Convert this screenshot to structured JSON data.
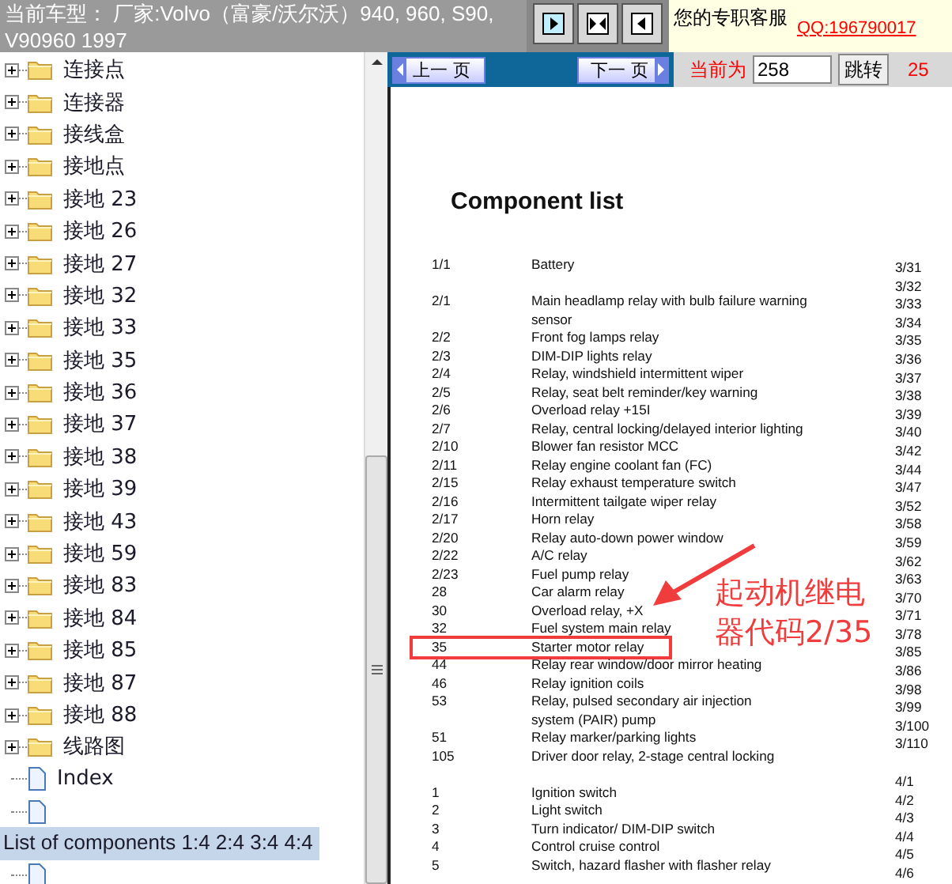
{
  "header": {
    "car_model": "当前车型：  厂家:Volvo（富豪/沃尔沃）940, 960, S90, V90960 1997",
    "service_label": "您的专职客服",
    "qq_link": "QQ:196790017"
  },
  "nav": {
    "prev": "上一 页",
    "next": "下一 页",
    "current_label": "当前为",
    "page_value": "258",
    "jump": "跳转",
    "total": "25"
  },
  "tree": [
    {
      "kind": "folder",
      "label": "连接点",
      "selected": false
    },
    {
      "kind": "folder",
      "label": "连接器",
      "selected": false
    },
    {
      "kind": "folder",
      "label": "接线盒",
      "selected": false
    },
    {
      "kind": "folder",
      "label": "接地点",
      "selected": false
    },
    {
      "kind": "folder",
      "label": "接地 23",
      "selected": false
    },
    {
      "kind": "folder",
      "label": "接地 26",
      "selected": false
    },
    {
      "kind": "folder",
      "label": "接地 27",
      "selected": false
    },
    {
      "kind": "folder",
      "label": "接地 32",
      "selected": false
    },
    {
      "kind": "folder",
      "label": "接地 33",
      "selected": false
    },
    {
      "kind": "folder",
      "label": "接地 35",
      "selected": false
    },
    {
      "kind": "folder",
      "label": "接地 36",
      "selected": false
    },
    {
      "kind": "folder",
      "label": "接地 37",
      "selected": false
    },
    {
      "kind": "folder",
      "label": "接地 38",
      "selected": false
    },
    {
      "kind": "folder",
      "label": "接地 39",
      "selected": false
    },
    {
      "kind": "folder",
      "label": "接地 43",
      "selected": false
    },
    {
      "kind": "folder",
      "label": "接地 59",
      "selected": false
    },
    {
      "kind": "folder",
      "label": "接地 83",
      "selected": false
    },
    {
      "kind": "folder",
      "label": "接地 84",
      "selected": false
    },
    {
      "kind": "folder",
      "label": "接地 85",
      "selected": false
    },
    {
      "kind": "folder",
      "label": "接地 87",
      "selected": false
    },
    {
      "kind": "folder",
      "label": "接地 88",
      "selected": false
    },
    {
      "kind": "folder",
      "label": "线路图",
      "selected": false
    },
    {
      "kind": "document",
      "label": "Index",
      "selected": false
    },
    {
      "kind": "document",
      "selected": false
    },
    {
      "kind": "text",
      "label": "List of components 1:4 2:4 3:4 4:4",
      "selected": true
    },
    {
      "kind": "document",
      "selected": false
    }
  ],
  "document": {
    "title": "Component list",
    "groups": [
      [
        {
          "code": "1/1",
          "lines": [
            "Battery"
          ],
          "highlighted": false
        }
      ],
      [
        {
          "code": "2/1",
          "lines": [
            "Main headlamp relay with bulb failure warning",
            "sensor"
          ],
          "highlighted": false
        },
        {
          "code": "2/2",
          "lines": [
            "Front fog lamps relay"
          ],
          "highlighted": false
        },
        {
          "code": "2/3",
          "lines": [
            "DIM-DIP lights relay"
          ],
          "highlighted": false
        },
        {
          "code": "2/4",
          "lines": [
            "Relay, windshield intermittent wiper"
          ],
          "highlighted": false
        },
        {
          "code": "2/5",
          "lines": [
            "Relay, seat belt reminder/key warning"
          ],
          "highlighted": false
        },
        {
          "code": "2/6",
          "lines": [
            "Overload relay +15I"
          ],
          "highlighted": false
        },
        {
          "code": "2/7",
          "lines": [
            "Relay, central locking/delayed interior lighting"
          ],
          "highlighted": false
        },
        {
          "code": "2/10",
          "lines": [
            "Blower fan resistor MCC"
          ],
          "highlighted": false
        },
        {
          "code": "2/11",
          "lines": [
            "Relay engine coolant fan (FC)"
          ],
          "highlighted": false
        },
        {
          "code": "2/15",
          "lines": [
            "Relay exhaust temperature switch"
          ],
          "highlighted": false
        },
        {
          "code": "2/16",
          "lines": [
            "Intermittent tailgate wiper relay"
          ],
          "highlighted": false
        },
        {
          "code": "2/17",
          "lines": [
            "Horn relay"
          ],
          "highlighted": false
        },
        {
          "code": "2/20",
          "lines": [
            "Relay auto-down power window"
          ],
          "highlighted": false
        },
        {
          "code": "2/22",
          "lines": [
            "A/C relay"
          ],
          "highlighted": false
        },
        {
          "code": "2/23",
          "lines": [
            "Fuel pump relay"
          ],
          "highlighted": false
        },
        {
          "code": "28",
          "lines": [
            "Car alarm relay"
          ],
          "highlighted": false
        },
        {
          "code": "30",
          "lines": [
            "Overload relay, +X"
          ],
          "highlighted": false
        },
        {
          "code": "32",
          "lines": [
            "Fuel system main relay"
          ],
          "highlighted": false
        },
        {
          "code": "35",
          "lines": [
            "Starter motor relay"
          ],
          "highlighted": true
        },
        {
          "code": "44",
          "lines": [
            "Relay rear window/door mirror heating"
          ],
          "highlighted": false
        },
        {
          "code": "46",
          "lines": [
            "Relay ignition coils"
          ],
          "highlighted": false
        },
        {
          "code": "53",
          "lines": [
            "Relay, pulsed secondary air injection",
            "system (PAIR) pump"
          ],
          "highlighted": false
        },
        {
          "code": "51",
          "lines": [
            "Relay marker/parking lights"
          ],
          "highlighted": false
        },
        {
          "code": "105",
          "lines": [
            "Driver door relay, 2-stage central locking"
          ],
          "highlighted": false
        }
      ],
      [
        {
          "code": "1",
          "lines": [
            "Ignition switch"
          ],
          "highlighted": false
        },
        {
          "code": "2",
          "lines": [
            "Light switch"
          ],
          "highlighted": false
        },
        {
          "code": "3",
          "lines": [
            "Turn indicator/ DIM-DIP switch"
          ],
          "highlighted": false
        },
        {
          "code": "4",
          "lines": [
            "Control cruise control"
          ],
          "highlighted": false
        },
        {
          "code": "5",
          "lines": [
            "Switch, hazard flasher with flasher relay"
          ],
          "highlighted": false
        }
      ]
    ],
    "right_column": [
      [
        "3/31",
        "3/32",
        "3/33",
        "3/34",
        "3/35",
        "3/36",
        "3/37",
        "3/38",
        "3/39",
        "3/40",
        "3/42",
        "3/44",
        "3/47",
        "3/52",
        "3/58",
        "3/59",
        "3/62",
        "3/63",
        "3/70",
        "3/71",
        "3/78",
        "3/85",
        "3/86",
        "3/98",
        "3/99",
        "3/100",
        "3/110"
      ],
      [
        "4/1",
        "4/2",
        "4/3",
        "4/4",
        "4/5",
        "4/6"
      ]
    ]
  },
  "annotation": {
    "lines": [
      "起动机继电",
      "器代码2/35"
    ]
  }
}
